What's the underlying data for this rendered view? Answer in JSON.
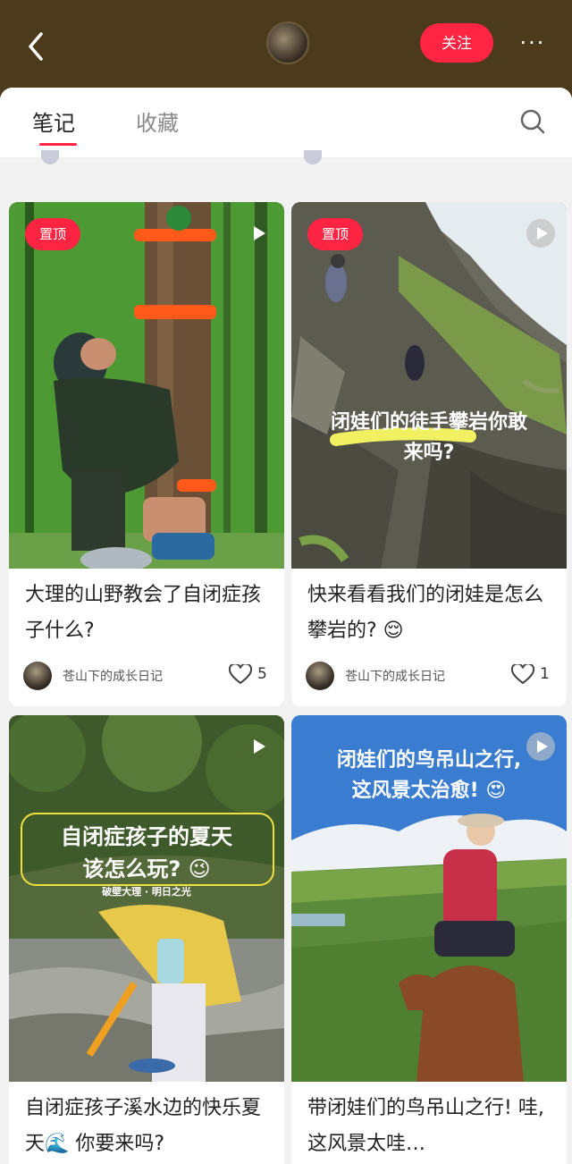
{
  "header": {
    "follow_label": "关注",
    "more_label": "···"
  },
  "tabs": [
    {
      "label": "笔记",
      "active": true
    },
    {
      "label": "收藏",
      "active": false
    }
  ],
  "colors": {
    "accent": "#ff2442",
    "header_bg": "#4b3b1c"
  },
  "cards": [
    {
      "pin_label": "置顶",
      "title": "大理的山野教会了自闭症孩子什么?",
      "author": "苍山下的成长日记",
      "likes": "5"
    },
    {
      "pin_label": "置顶",
      "overlay_line1": "闭娃们的徒手攀岩你敢",
      "overlay_line2": "来吗?",
      "title": "快来看看我们的闭娃是怎么攀岩的? 😌",
      "author": "苍山下的成长日记",
      "likes": "1"
    },
    {
      "overlay_line1": "自闭症孩子的夏天",
      "overlay_line2": "该怎么玩? 😉",
      "overlay_small": "破壁大理 · 明日之光",
      "title": "自闭症孩子溪水边的快乐夏天🌊 你要来吗?"
    },
    {
      "overlay_line1": "闭娃们的鸟吊山之行,",
      "overlay_line2": "这风景太治愈! 😍",
      "title": "带闭娃们的鸟吊山之行! 哇, 这风景太哇…"
    }
  ]
}
